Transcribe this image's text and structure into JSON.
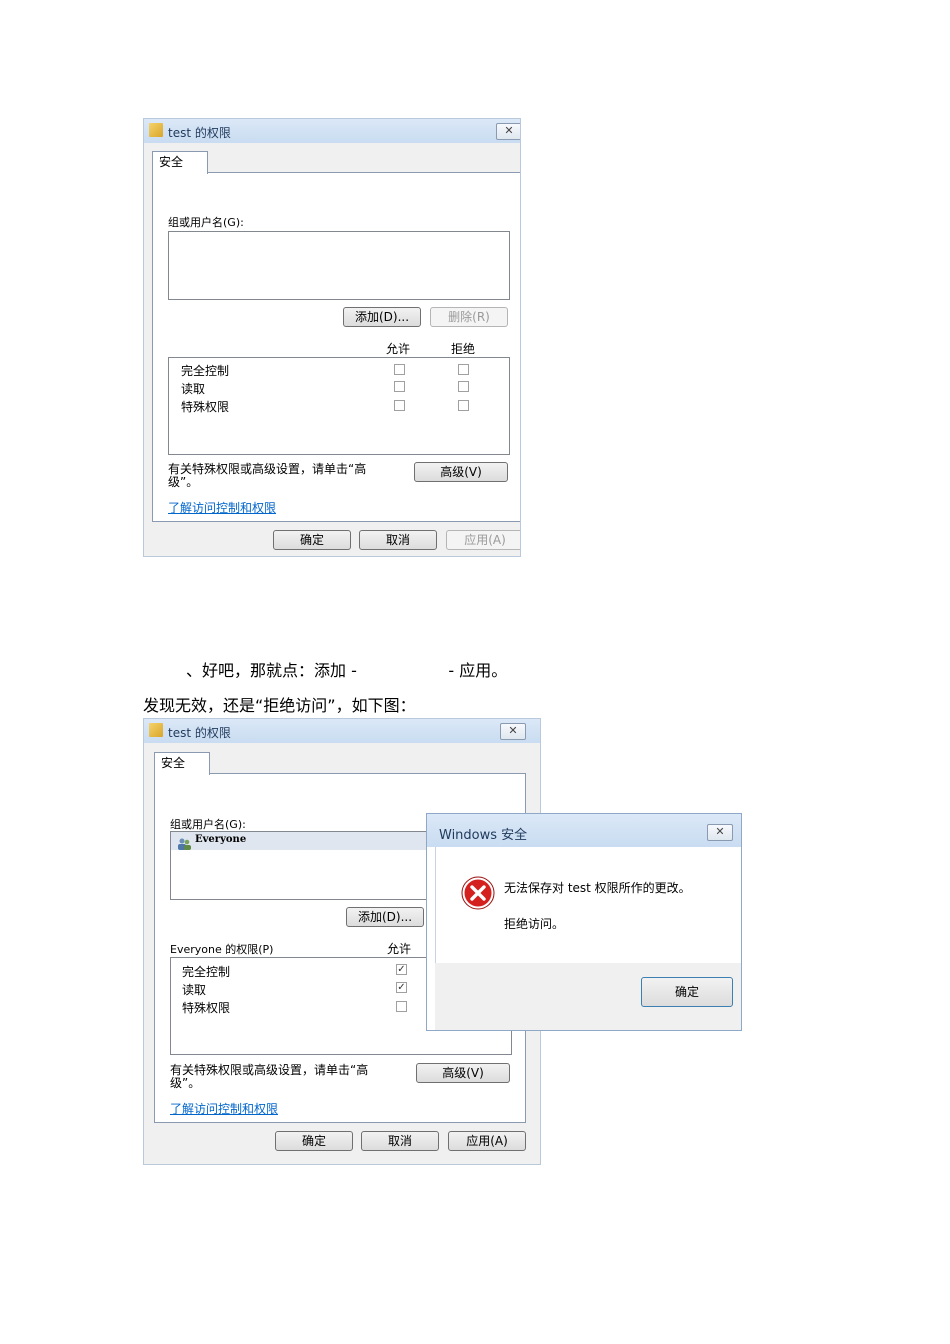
{
  "dialog1": {
    "title": "test 的权限",
    "close_glyph": "✕",
    "tab": "安全",
    "group_label": "组或用户名(G):",
    "add_button": "添加(D)...",
    "remove_button": "删除(R)",
    "col_allow": "允许",
    "col_deny": "拒绝",
    "permissions": [
      "完全控制",
      "读取",
      "特殊权限"
    ],
    "advanced_text_line1": "有关特殊权限或高级设置，请单击“高",
    "advanced_text_line2": "级”。",
    "advanced_button": "高级(V)",
    "learn_link": "了解访问控制和权限",
    "ok_button": "确定",
    "cancel_button": "取消",
    "apply_button": "应用(A)"
  },
  "body_text": {
    "line1": "、好吧，那就点：添加 -                  - 应用。",
    "line2": "发现无效，还是“拒绝访问”，如下图："
  },
  "dialog2": {
    "title": "test 的权限",
    "close_glyph": "✕",
    "tab": "安全",
    "group_label": "组或用户名(G):",
    "user": "Everyone",
    "add_button": "添加(D)...",
    "perm_label": "Everyone 的权限(P)",
    "col_allow": "允许",
    "permissions": [
      "完全控制",
      "读取",
      "特殊权限"
    ],
    "allow_checked": [
      true,
      true,
      false
    ],
    "check_glyph": "✓",
    "advanced_text_line1": "有关特殊权限或高级设置，请单击“高",
    "advanced_text_line2": "级”。",
    "advanced_button": "高级(V)",
    "learn_link": "了解访问控制和权限",
    "ok_button": "确定",
    "cancel_button": "取消",
    "apply_button": "应用(A)"
  },
  "error_dialog": {
    "title": "Windows 安全",
    "close_glyph": "✕",
    "icon": "error-icon",
    "message": "无法保存对 test 权限所作的更改。",
    "detail": "拒绝访问。",
    "ok_button": "确定",
    "accent": "#d4201e"
  }
}
